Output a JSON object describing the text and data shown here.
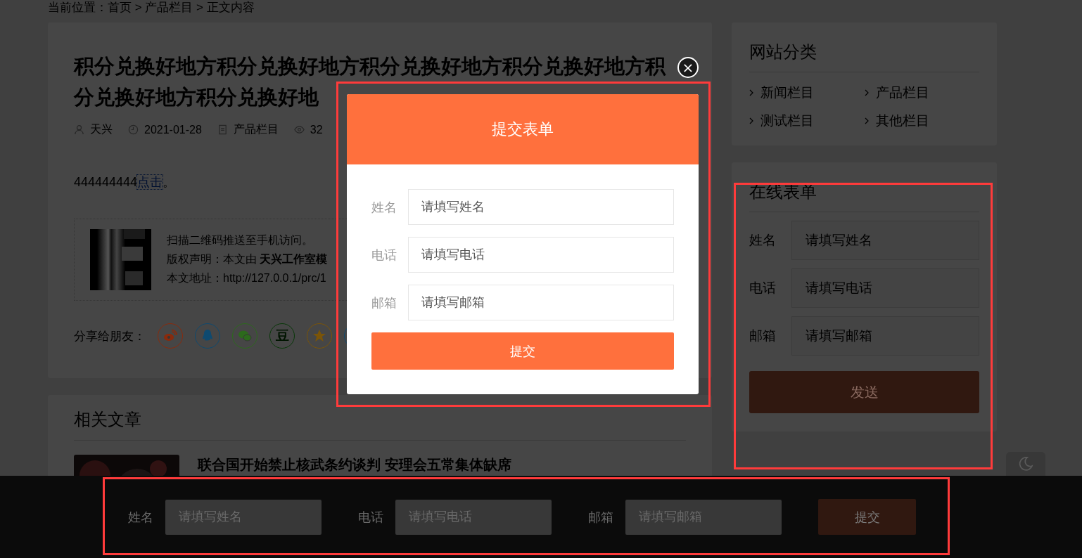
{
  "breadcrumb": "当前位置：首页 > 产品栏目 > 正文内容",
  "article": {
    "title_lines": [
      "积分兑换好地方积分兑换好地方积分兑换好地方积分兑换好地方积",
      "分兑换好地方积分兑换好地"
    ],
    "meta": [
      {
        "kind": "author",
        "text": "天兴"
      },
      {
        "kind": "date",
        "text": "2021-01-28"
      },
      {
        "kind": "category",
        "text": "产品栏目"
      },
      {
        "kind": "views",
        "text": "32"
      }
    ],
    "body": {
      "text": "444444444",
      "link": "点击",
      "tail": "。"
    },
    "qr_lines": [
      "扫描二维码推送至手机访问。",
      "版权声明：本文由 **天兴工作室模**",
      "本文地址：http://127.0.0.1/prc/1"
    ],
    "share": {
      "label": "分享给朋友：",
      "buttons": [
        {
          "kind": "weibo",
          "color": "#8a2a0c"
        },
        {
          "kind": "qq",
          "color": "#0e4a70"
        },
        {
          "kind": "wechat",
          "color": "#2c6a1c"
        },
        {
          "kind": "douban",
          "color": "#083808",
          "text": "豆"
        },
        {
          "kind": "qzone",
          "color": "#7a5408"
        },
        {
          "kind": "other",
          "color": "#0e4a70"
        }
      ]
    }
  },
  "related": {
    "heading": "相关文章",
    "items": [
      {
        "title": "联合国开始禁止核武条约谈判 安理会五常集体缺席"
      }
    ]
  },
  "sidebar": {
    "categories": {
      "heading": "网站分类",
      "items": [
        "新闻栏目",
        "产品栏目",
        "测试栏目",
        "其他栏目"
      ]
    },
    "form": {
      "heading": "在线表单",
      "fields": [
        {
          "label": "姓名",
          "placeholder": "请填写姓名"
        },
        {
          "label": "电话",
          "placeholder": "请填写电话"
        },
        {
          "label": "邮箱",
          "placeholder": "请填写邮箱"
        }
      ],
      "button": "发送"
    }
  },
  "modal": {
    "title": "提交表单",
    "close": "×",
    "fields": [
      {
        "label": "姓名",
        "placeholder": "请填写姓名"
      },
      {
        "label": "电话",
        "placeholder": "请填写电话"
      },
      {
        "label": "邮箱",
        "placeholder": "请填写邮箱"
      }
    ],
    "button": "提交"
  },
  "bottom_bar": {
    "fields": [
      {
        "label": "姓名",
        "placeholder": "请填写姓名"
      },
      {
        "label": "电话",
        "placeholder": "请填写电话"
      },
      {
        "label": "邮箱",
        "placeholder": "请填写邮箱"
      }
    ],
    "button": "提交"
  }
}
